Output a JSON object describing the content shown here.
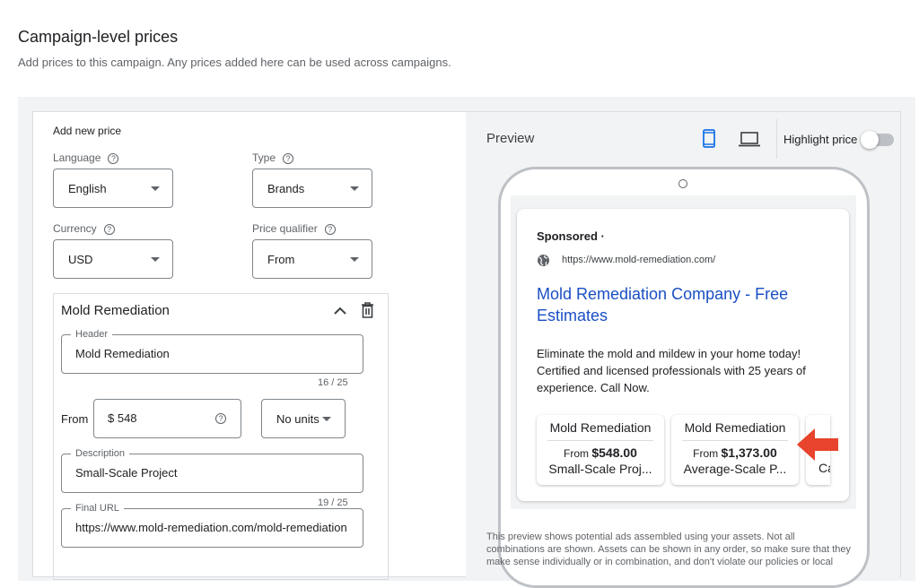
{
  "page": {
    "title": "Campaign-level prices",
    "subtitle": "Add prices to this campaign. Any prices added here can be used across campaigns."
  },
  "form": {
    "heading": "Add new price",
    "language": {
      "label": "Language",
      "value": "English"
    },
    "type": {
      "label": "Type",
      "value": "Brands"
    },
    "currency": {
      "label": "Currency",
      "value": "USD"
    },
    "qualifier": {
      "label": "Price qualifier",
      "value": "From"
    },
    "item": {
      "title": "Mold Remediation",
      "header": {
        "label": "Header",
        "value": "Mold Remediation",
        "count": "16 / 25"
      },
      "price_prefix": "From",
      "price": "$ 548",
      "units": "No units",
      "description": {
        "label": "Description",
        "value": "Small-Scale Project",
        "count": "19 / 25"
      },
      "final_url": {
        "label": "Final URL",
        "value": "https://www.mold-remediation.com/mold-remediation"
      }
    }
  },
  "preview": {
    "label": "Preview",
    "selected_device": "mobile",
    "highlight_label": "Highlight price",
    "highlight_on": false,
    "ad": {
      "sponsored": "Sponsored ·",
      "url": "https://www.mold-remediation.com/",
      "headline": "Mold Remediation Company - Free Estimates",
      "body": "Eliminate the mold and mildew in your home today! Certified and licensed professionals with 25 years of experience. Call Now.",
      "cards": [
        {
          "header": "Mold Remediation",
          "qualifier": "From",
          "price": "$548.00",
          "description": "Small-Scale Proj..."
        },
        {
          "header": "Mold Remediation",
          "qualifier": "From",
          "price": "$1,373.00",
          "description": "Average-Scale P..."
        },
        {
          "header": "",
          "qualifier": "",
          "price": "",
          "description": "Ca"
        }
      ]
    },
    "footer": [
      "This preview shows potential ads assembled using your assets. Not all",
      "combinations are shown. Assets can be shown in any order, so make sure that they",
      "make sense individually or in combination, and don't violate our policies or local"
    ],
    "colors": {
      "accent": "#1a73e8",
      "link": "#1a0dab",
      "arrow": "#e8432c"
    }
  }
}
